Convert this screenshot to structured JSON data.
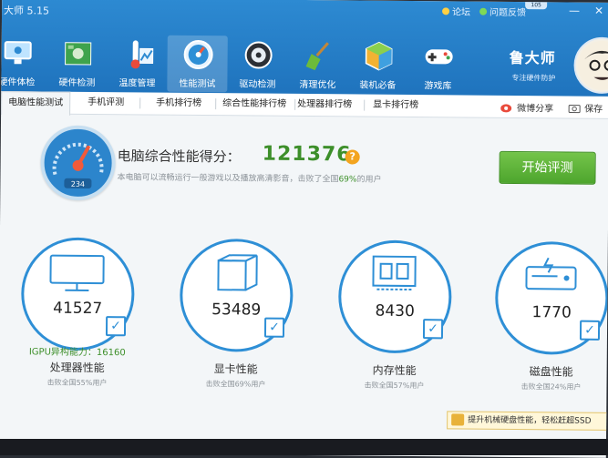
{
  "title_bar": {
    "version": "大师 5.15",
    "links": [
      "论坛",
      "问题反馈"
    ],
    "window_buttons": [
      "—",
      "✕"
    ],
    "badge": "105"
  },
  "nav": {
    "items": [
      {
        "label": "硬件体检",
        "icon": "monitor-check-icon"
      },
      {
        "label": "硬件检测",
        "icon": "chip-board-icon"
      },
      {
        "label": "温度管理",
        "icon": "thermometer-icon"
      },
      {
        "label": "性能测试",
        "icon": "speedometer-icon",
        "active": true
      },
      {
        "label": "驱动检测",
        "icon": "gear-icon"
      },
      {
        "label": "清理优化",
        "icon": "broom-icon"
      },
      {
        "label": "装机必备",
        "icon": "cube-icon"
      },
      {
        "label": "游戏库",
        "icon": "gamepad-icon"
      }
    ],
    "brand": "鲁大师",
    "brand_sub": "专注硬件防护"
  },
  "tabs": {
    "items": [
      {
        "label": "电脑性能测试",
        "active": true
      },
      {
        "label": "手机评测"
      },
      {
        "label": "手机排行榜"
      },
      {
        "label": "综合性能排行榜"
      },
      {
        "label": "处理器排行榜"
      },
      {
        "label": "显卡排行榜"
      }
    ],
    "share_label": "微博分享",
    "screenshot_label": "保存"
  },
  "score": {
    "label": "电脑综合性能得分：",
    "value": "121376",
    "help": "?",
    "desc_prefix": "本电脑可以流畅运行一般游戏以及播放高清影音，击败了全国",
    "desc_percent": "69%",
    "desc_suffix": "的用户",
    "gauge_reading": "234",
    "button": "开始评测"
  },
  "metrics": [
    {
      "value": "41527",
      "name": "处理器性能",
      "sub": "击败全国55%用户",
      "extra": "IGPU异构能力：16160",
      "icon": "monitor-icon"
    },
    {
      "value": "53489",
      "name": "显卡性能",
      "sub": "击败全国69%用户",
      "icon": "3d-box-icon"
    },
    {
      "value": "8430",
      "name": "内存性能",
      "sub": "击败全国57%用户",
      "icon": "memory-chip-icon"
    },
    {
      "value": "1770",
      "name": "磁盘性能",
      "sub": "击败全国24%用户",
      "icon": "hard-disk-icon"
    }
  ],
  "bottom_tip": "提升机械硬盘性能，轻松赶超SSD",
  "colors": {
    "header": "#2d8ad2",
    "accent": "#2e8fd6",
    "score_green": "#3d8f2a",
    "button_green": "#5cb236",
    "help_orange": "#f3a41f"
  }
}
